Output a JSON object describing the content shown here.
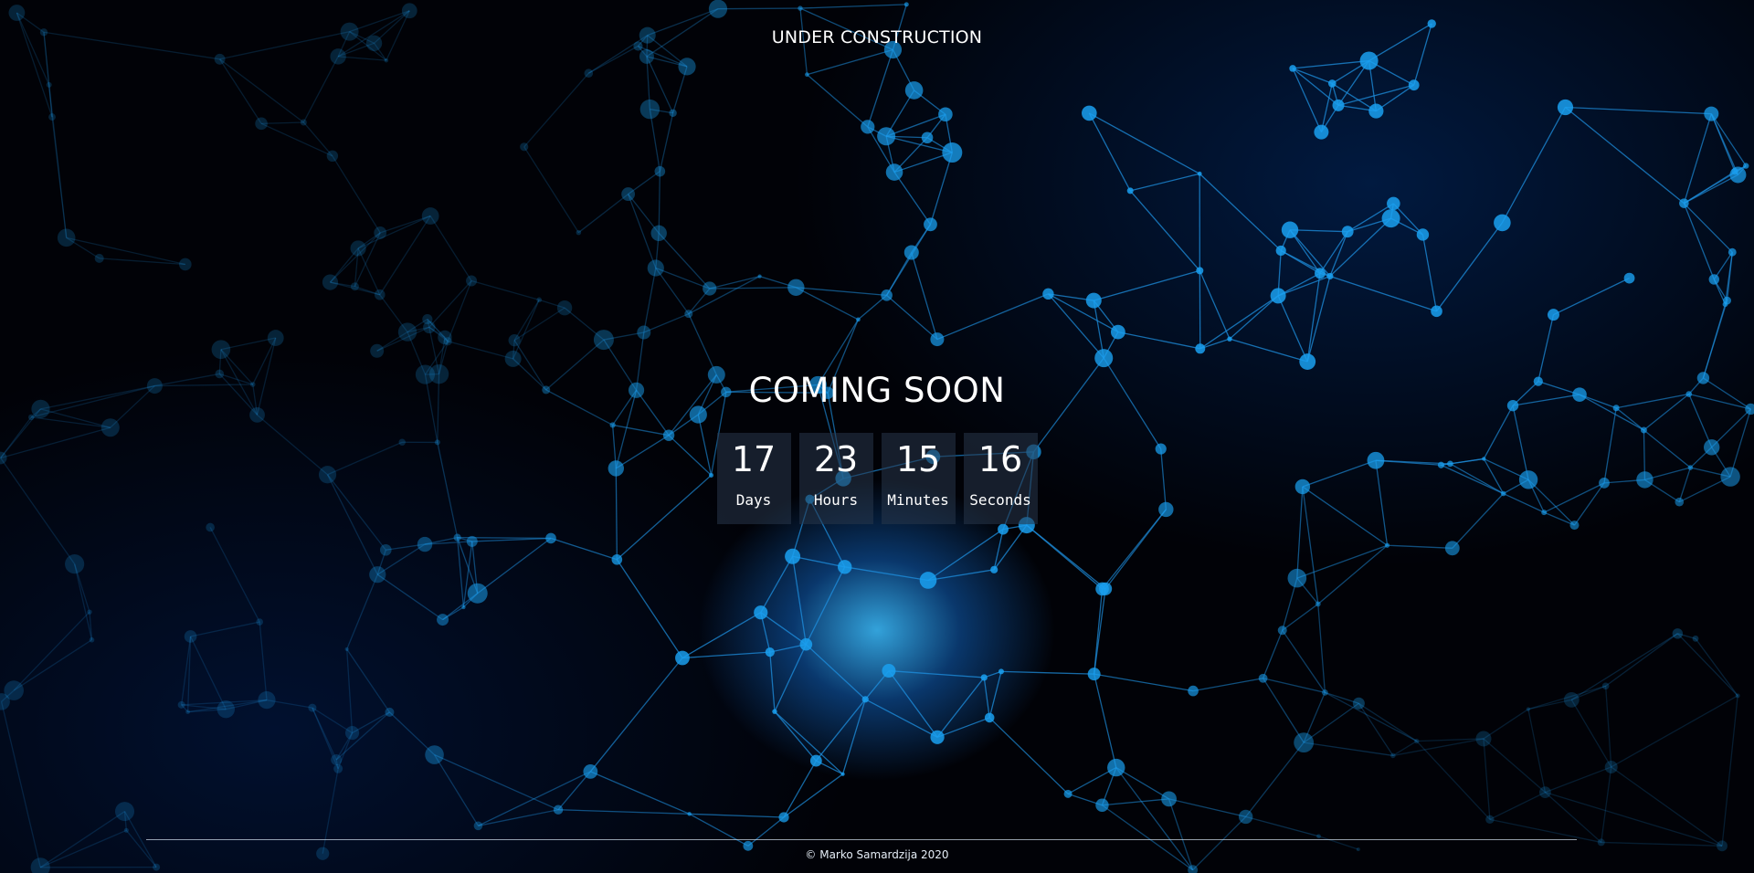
{
  "header": {
    "title": "UNDER CONSTRUCTION"
  },
  "hero": {
    "heading": "COMING SOON"
  },
  "countdown": [
    {
      "value": "17",
      "label": "Days"
    },
    {
      "value": "23",
      "label": "Hours"
    },
    {
      "value": "15",
      "label": "Minutes"
    },
    {
      "value": "16",
      "label": "Seconds"
    }
  ],
  "footer": {
    "copyright": "© Marko Samardzija 2020"
  },
  "colors": {
    "background": "#010207",
    "network_line": "#1e90e0",
    "network_node": "#1aa0f0",
    "glow": "#3cbeff",
    "countdown_box": "#28374b"
  },
  "background_image": "network-mesh-illustration"
}
